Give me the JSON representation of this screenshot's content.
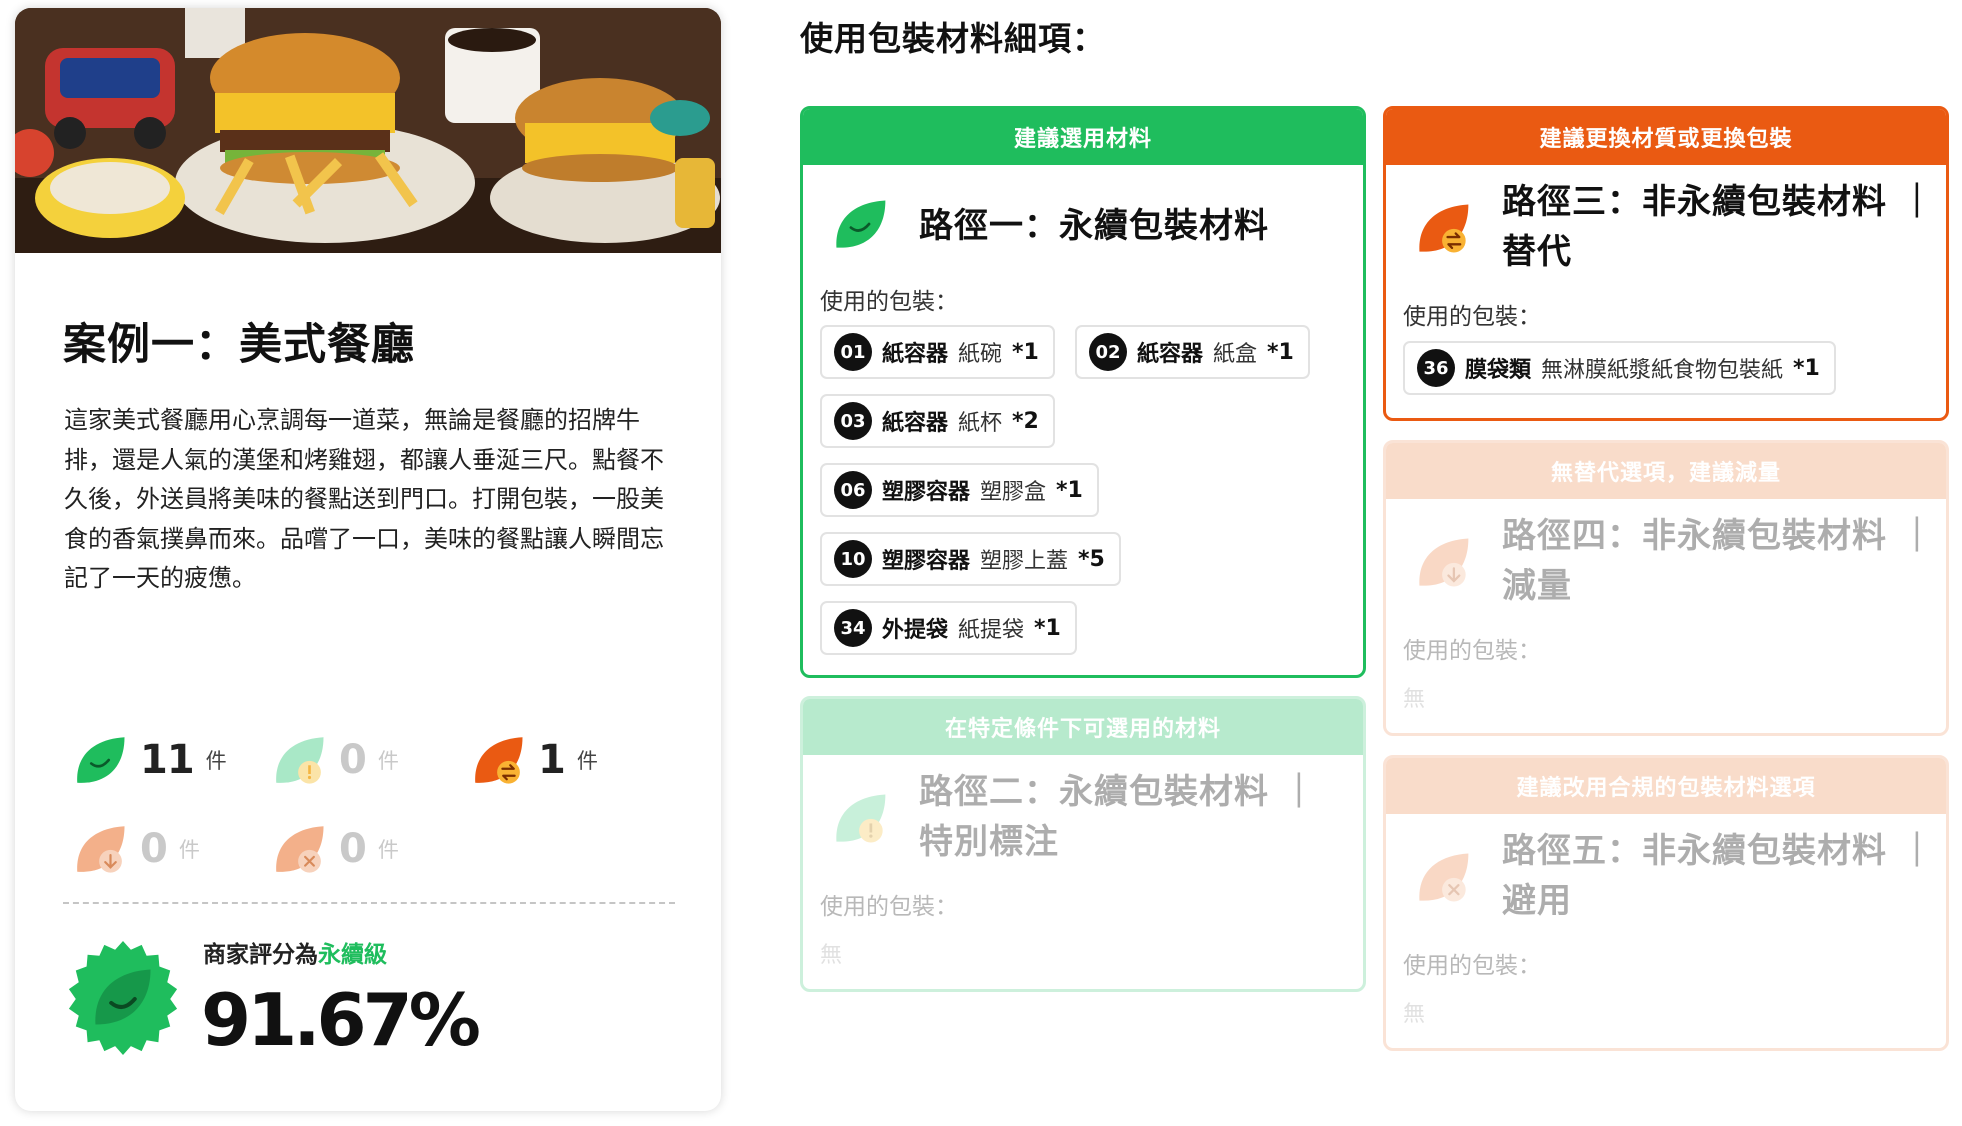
{
  "case": {
    "title": "案例一：美式餐廳",
    "description": "這家美式餐廳用心烹調每一道菜，無論是餐廳的招牌牛排，還是人氣的漢堡和烤雞翅，都讓人垂涎三尺。點餐不久後，外送員將美味的餐點送到門口。打開包裝，一股美食的香氣撲鼻而來。品嚐了一口，美味的餐點讓人瞬間忘記了一天的疲憊。",
    "stats": [
      {
        "icon": "green-leaf-icon",
        "count": "11",
        "unit": "件"
      },
      {
        "icon": "mint-leaf-warning-icon",
        "count": "0",
        "unit": "件"
      },
      {
        "icon": "orange-leaf-swap-icon",
        "count": "1",
        "unit": "件"
      },
      {
        "icon": "peach-leaf-down-icon",
        "count": "0",
        "unit": "件"
      },
      {
        "icon": "peach-leaf-x-icon",
        "count": "0",
        "unit": "件"
      }
    ],
    "rating_prefix": "商家評分為",
    "rating_level": "永續級",
    "rating_score": "91.67%"
  },
  "section_title": "使用包裝材料細項：",
  "routes": {
    "r1": {
      "header": "建議選用材料",
      "name_line1": "路徑一：永續包裝材料",
      "used_label": "使用的包裝：",
      "items": [
        {
          "no": "01",
          "category": "紙容器",
          "item": "紙碗",
          "qty": "*1"
        },
        {
          "no": "02",
          "category": "紙容器",
          "item": "紙盒",
          "qty": "*1"
        },
        {
          "no": "03",
          "category": "紙容器",
          "item": "紙杯",
          "qty": "*2"
        },
        {
          "no": "06",
          "category": "塑膠容器",
          "item": "塑膠盒",
          "qty": "*1"
        },
        {
          "no": "10",
          "category": "塑膠容器",
          "item": "塑膠上蓋",
          "qty": "*5"
        },
        {
          "no": "34",
          "category": "外提袋",
          "item": "紙提袋",
          "qty": "*1"
        }
      ]
    },
    "r2": {
      "header": "在特定條件下可選用的材料",
      "name_line1": "路徑二：永續包裝材料 ｜",
      "name_line2": "特別標注",
      "used_label": "使用的包裝：",
      "none_text": "無"
    },
    "r3": {
      "header": "建議更換材質或更換包裝",
      "name_line1": "路徑三：非永續包裝材料 ｜",
      "name_line2": "替代",
      "used_label": "使用的包裝：",
      "items": [
        {
          "no": "36",
          "category": "膜袋類",
          "item": "無淋膜紙漿紙食物包裝紙",
          "qty": "*1"
        }
      ]
    },
    "r4": {
      "header": "無替代選項，建議減量",
      "name_line1": "路徑四：非永續包裝材料 ｜",
      "name_line2": "減量",
      "used_label": "使用的包裝：",
      "none_text": "無"
    },
    "r5": {
      "header": "建議改用合規的包裝材料選項",
      "name_line1": "路徑五：非永續包裝材料 ｜",
      "name_line2": "避用",
      "used_label": "使用的包裝：",
      "none_text": "無"
    }
  },
  "colors": {
    "green": "#1fbd5d",
    "mint": "#a9e8c7",
    "orange": "#ea5a12",
    "peach": "#f3b08a"
  }
}
